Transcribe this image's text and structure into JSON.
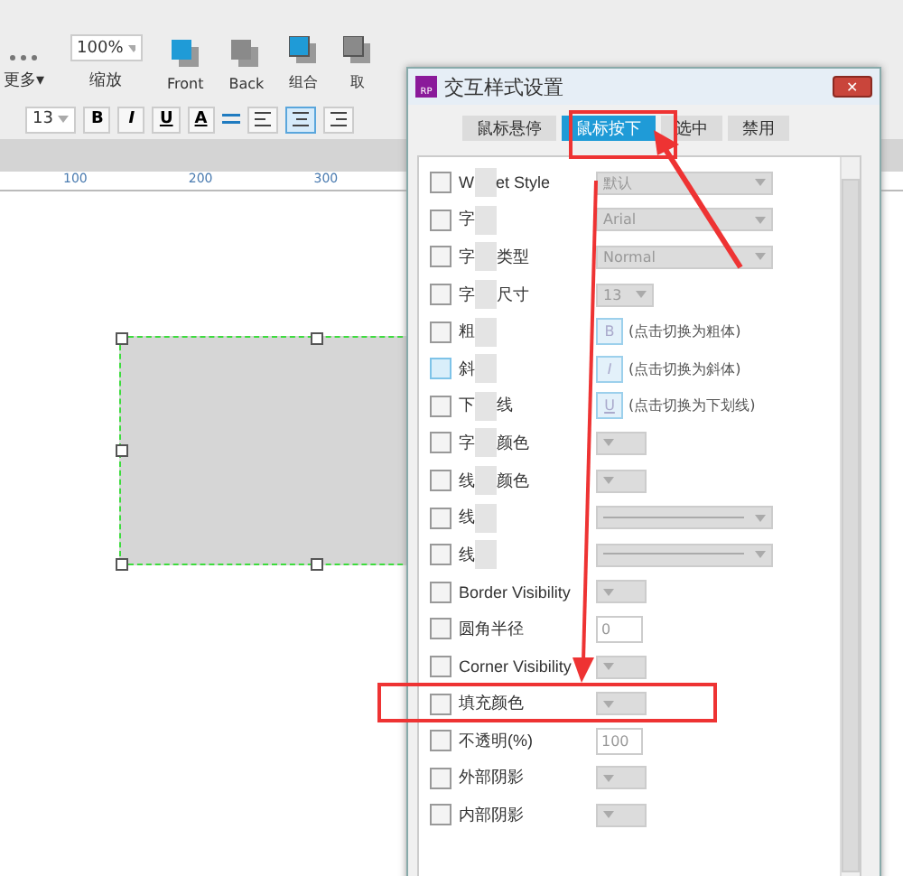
{
  "toolbar": {
    "more": "更多▾",
    "zoom": {
      "value": "100%",
      "label": "缩放"
    },
    "buttons": [
      {
        "label": "Front",
        "kind": "front"
      },
      {
        "label": "Back",
        "kind": "back"
      },
      {
        "label": "组合",
        "kind": "group"
      },
      {
        "label": "取",
        "kind": "ungroup"
      }
    ]
  },
  "format_bar": {
    "font_size": "13",
    "styles": [
      "B",
      "I",
      "U"
    ],
    "color_letter": "A",
    "aligns": [
      {
        "selected": false
      },
      {
        "selected": true
      },
      {
        "selected": false
      }
    ]
  },
  "ruler": {
    "ticks": [
      "100",
      "200",
      "300"
    ]
  },
  "dialog": {
    "title": "交互样式设置",
    "logo": "RP",
    "close": "✕",
    "tabs": [
      {
        "label": "鼠标悬停",
        "selected": false
      },
      {
        "label": "鼠标按下",
        "selected": true
      },
      {
        "label": "选中",
        "selected": false
      },
      {
        "label": "禁用",
        "selected": false
      }
    ],
    "rows": [
      {
        "label_parts": [
          "W",
          "et Style"
        ],
        "blurred": true,
        "kind": "select",
        "value": "默认",
        "checked": false
      },
      {
        "label_parts": [
          "字"
        ],
        "blurred": true,
        "kind": "select",
        "value": "Arial",
        "checked": false
      },
      {
        "label_parts": [
          "字",
          "类型"
        ],
        "blurred": true,
        "kind": "select",
        "value": "Normal",
        "checked": false
      },
      {
        "label_parts": [
          "字",
          "尺寸"
        ],
        "blurred": true,
        "kind": "small_select",
        "value": "13",
        "checked": false
      },
      {
        "label_parts": [
          "粗"
        ],
        "blurred": true,
        "kind": "toggle",
        "value": "B",
        "hint": "(点击切换为粗体)",
        "checked": false
      },
      {
        "label_parts": [
          "斜"
        ],
        "blurred": true,
        "kind": "toggle",
        "value": "I",
        "hint": "(点击切换为斜体)",
        "checked": true
      },
      {
        "label_parts": [
          "下",
          "线"
        ],
        "blurred": true,
        "kind": "toggle",
        "value": "U",
        "hint": "(点击切换为下划线)",
        "checked": false
      },
      {
        "label_parts": [
          "字",
          "颜色"
        ],
        "blurred": true,
        "kind": "font_color",
        "checked": false
      },
      {
        "label_parts": [
          "线",
          "颜色"
        ],
        "blurred": true,
        "kind": "line_color",
        "checked": false
      },
      {
        "label_parts": [
          "线"
        ],
        "blurred": true,
        "kind": "line",
        "checked": false
      },
      {
        "label_parts": [
          "线"
        ],
        "blurred": true,
        "kind": "line",
        "checked": false
      },
      {
        "label_parts": [
          "Border Visibility"
        ],
        "kind": "border",
        "checked": false
      },
      {
        "label_parts": [
          "圆角半径"
        ],
        "kind": "number",
        "value": "0",
        "checked": false
      },
      {
        "label_parts": [
          "Corner Visibility"
        ],
        "kind": "corner",
        "checked": false
      },
      {
        "label_parts": [
          "填充颜色"
        ],
        "kind": "fill",
        "checked": false
      },
      {
        "label_parts": [
          "不透明(%)"
        ],
        "kind": "number",
        "value": "100",
        "checked": false
      },
      {
        "label_parts": [
          "外部阴影"
        ],
        "kind": "shadow",
        "checked": false
      },
      {
        "label_parts": [
          "内部阴影"
        ],
        "kind": "inner_shadow",
        "checked": false
      }
    ]
  }
}
